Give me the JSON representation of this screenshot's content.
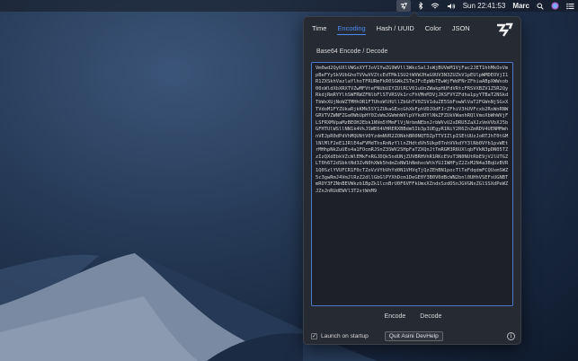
{
  "menubar": {
    "time": "Sun 22:41:53",
    "user": "Marc",
    "icons": [
      "devhelp-app-icon",
      "bluetooth-icon",
      "wifi-icon",
      "volume-icon",
      "search-icon",
      "siri-icon",
      "notification-center-icon"
    ]
  },
  "panel": {
    "tabs": [
      {
        "label": "Time",
        "active": false
      },
      {
        "label": "Encoding",
        "active": true
      },
      {
        "label": "Hash / UUID",
        "active": false
      },
      {
        "label": "Color",
        "active": false
      },
      {
        "label": "JSON",
        "active": false
      }
    ],
    "section_title": "Base64 Encode / Decode",
    "text_value": "Vm0wd2QyUXlVWGxXYTJoV1YwZG9WVll3WkcSalJsWjBUVmM1VjFac2JET1hhMkOxVmpBeFYySkVUbGhoTVVwVVZtcEdTMk1SU2tWVWJHaG9UV3N3ZUZkV1pEUlpWMDEOVjI1R1ZXSkhVazlaYlhoTFRURmFkR0SGWkZSTmJFcEpWbTEwWjFWdFNrZFhiaABpXWWxob00xWldXbXRXTVZwMFVteFNUbUIYZUlRCV01uUnZWakpHUFdVRtcFRSVXBZV1Z5R2QyRkdjRmRYYlhSWFRWZFNlbFlSTVRSVk1rcFhVMnM3VjJKSFVYZFdha1pyYTBaT2NSkdTbWxXUjNoWZTMHhOR1FTUhoWlHUllZbGhTV0ZSV1duZE5SbFowWlVaT2FGWnNjSGxXTVdoM1FYZUkaRjkKMk5SY1ZUkaGExcGhXbFphVDJOdFJrZFhiV3hUVFcxb2RsWnRNWGRVTVZWNFZGa0WbUpHY0ZsWmJGWmhWVlpVYkdOYlNkZFZUkVWanhRQlVmoXbWhWVjFLSFRXMVpaMzBEOHJEbk1NVm5YMmFlVjNrbmNEbnJrbWVvU2xDRU5ZaXJzVmVVbXJ5bGFHTUlWSllNN1k4VkJSWE04VHRERXBBdm5Ib3p3UEgyR1NiY2R6ZnZmRDV4UENMMmhnVEJpR0dPdVhMQUNtV0YzdmNVR2ZONkhBR0NQTDZpTTVIZlpISEtUUzJoRTJhT0tGMlNlMlF2eE1JRlE4aFVMdThsRnNzYllnZHdtdVh5Ukp0TnhVVkdYY3lNb0VYb1pvWEtrMHhpNkZuUEs4a1FOcmRJSnZ3SWV2SHpFaTZXQnJtTmRGM3R6UXlqbFVkN3pDN05TZzIzQXdEbkVZcWlEMkFnRGJDQk5ndUNjZUVBRHVhR1RKcEVoT3N0NUtRbE9jV2lUTGZLT0h6T2dSbktNd3ZvN0hXWk5hdmZoNW1hNmhocWtkYUJIWHFyZ2ZxM2N4a3BqUzBVR1Q0SzlYVUFCR1F0cTZoVzVYbVhYd0N1VHVqTjQzZEhBN1pocTlTeFdqdmFCQUxmSWZ5c3gwRmJ4VmJlRzZ2dllGbGlPYXhDcm1DeGE0Y3B0V0dBcWN2bnl0UHhVSEFsUGNBTmROY3FZNnBEVWkzb1BpZk1lcnBrU0F6VFFkUmxXZndxSzdOSnJGVGNxZGlSSXdPeWZJZnJnRUdEWVl3T2xtWnM9",
    "buttons": {
      "encode": "Encode",
      "decode": "Decode"
    },
    "startup_label": "Launch on startup",
    "startup_checked": true,
    "quit_label": "Quit Asini DevHelp",
    "info_glyph": "i"
  }
}
